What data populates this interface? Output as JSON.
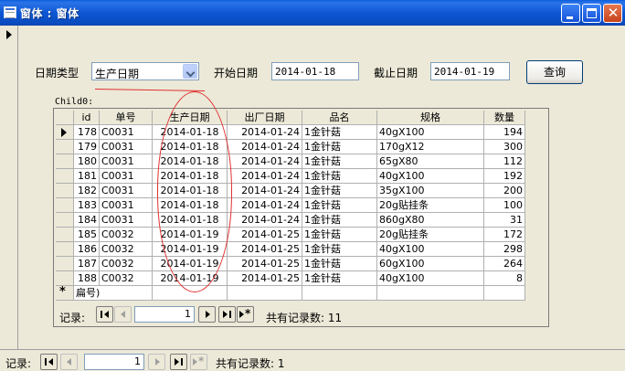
{
  "window": {
    "title": "窗体 : 窗体"
  },
  "filter": {
    "date_type_label": "日期类型",
    "date_type_value": "生产日期",
    "start_label": "开始日期",
    "start_value": "2014-01-18",
    "end_label": "截止日期",
    "end_value": "2014-01-19",
    "query_button": "查询"
  },
  "subform": {
    "name_label": "Child0:",
    "columns": [
      "id",
      "单号",
      "生产日期",
      "出厂日期",
      "品名",
      "规格",
      "数量"
    ],
    "rows": [
      [
        "178",
        "C0031",
        "2014-01-18",
        "2014-01-24",
        "1金针菇",
        "40gX100",
        "194"
      ],
      [
        "179",
        "C0031",
        "2014-01-18",
        "2014-01-24",
        "1金针菇",
        "170gX12",
        "300"
      ],
      [
        "180",
        "C0031",
        "2014-01-18",
        "2014-01-24",
        "1金针菇",
        "65gX80",
        "112"
      ],
      [
        "181",
        "C0031",
        "2014-01-18",
        "2014-01-24",
        "1金针菇",
        "40gX100",
        "192"
      ],
      [
        "182",
        "C0031",
        "2014-01-18",
        "2014-01-24",
        "1金针菇",
        "35gX100",
        "200"
      ],
      [
        "183",
        "C0031",
        "2014-01-18",
        "2014-01-24",
        "1金针菇",
        "20g贴挂条",
        "100"
      ],
      [
        "184",
        "C0031",
        "2014-01-18",
        "2014-01-24",
        "1金针菇",
        "860gX80",
        "31"
      ],
      [
        "185",
        "C0032",
        "2014-01-19",
        "2014-01-25",
        "1金针菇",
        "20g贴挂条",
        "172"
      ],
      [
        "186",
        "C0032",
        "2014-01-19",
        "2014-01-25",
        "1金针菇",
        "40gX100",
        "298"
      ],
      [
        "187",
        "C0032",
        "2014-01-19",
        "2014-01-25",
        "1金针菇",
        "60gX100",
        "264"
      ],
      [
        "188",
        "C0032",
        "2014-01-19",
        "2014-01-25",
        "1金针菇",
        "40gX100",
        "8"
      ]
    ],
    "new_row_text": "扁号)",
    "nav": {
      "label": "记录:",
      "current": "1",
      "total_text": "共有记录数: 11"
    }
  },
  "main_nav": {
    "label": "记录:",
    "current": "1",
    "total_text": "共有记录数: 1"
  },
  "colors": {
    "annotation_red": "#e03030",
    "titlebar_blue": "#0a57d4"
  }
}
